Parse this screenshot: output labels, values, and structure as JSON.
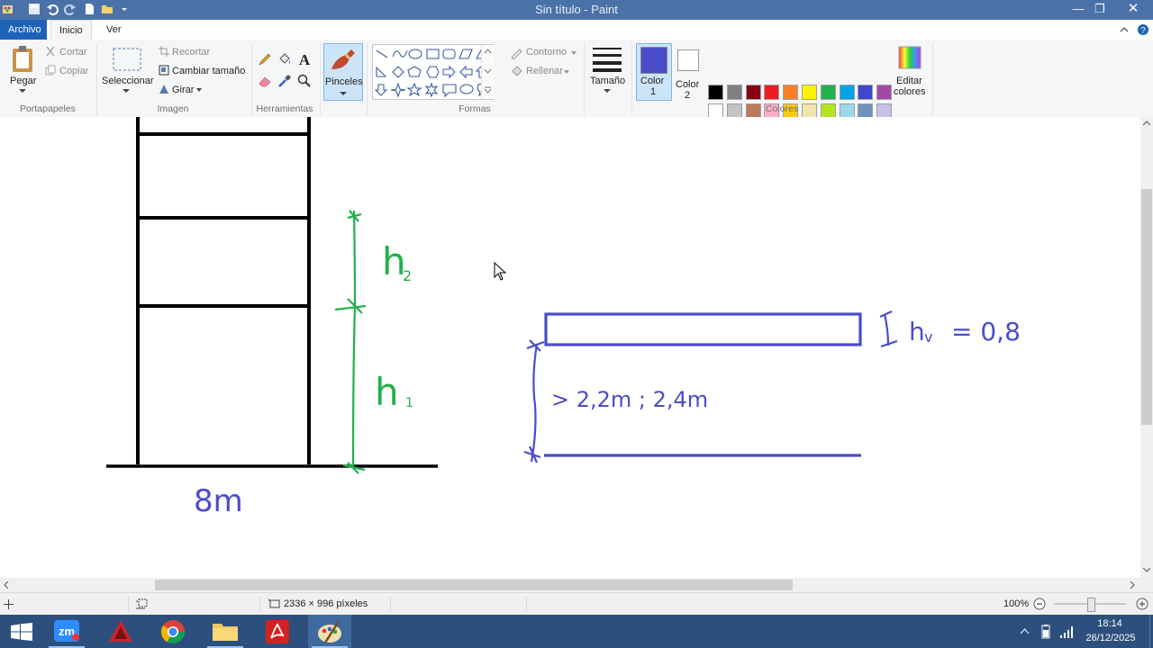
{
  "window": {
    "title": "Sin título - Paint",
    "controls": [
      "minimize",
      "restore",
      "close"
    ]
  },
  "tabs": [
    {
      "label": "Archivo"
    },
    {
      "label": "Inicio"
    },
    {
      "label": "Ver"
    }
  ],
  "ribbon": {
    "clipboard": {
      "paste": "Pegar",
      "cut": "Cortar",
      "copy": "Copiar",
      "group": "Portapapeles"
    },
    "image": {
      "select": "Seleccionar",
      "crop": "Recortar",
      "resize": "Cambiar tamaño",
      "rotate": "Girar",
      "group": "Imagen"
    },
    "tools": {
      "group": "Herramientas"
    },
    "brushes": {
      "label": "Pinceles"
    },
    "shapes": {
      "outline": "Contorno",
      "fill": "Rellenar",
      "group": "Formas"
    },
    "size": {
      "label": "Tamaño"
    },
    "colors": {
      "color1_line1": "Color",
      "color1_line2": "1",
      "color2_line1": "Color",
      "color2_line2": "2",
      "edit_line1": "Editar",
      "edit_line2": "colores",
      "group": "Colores",
      "color1": "#4a4dc8",
      "color2": "#ffffff",
      "palette_row1": [
        "#000000",
        "#7f7f7f",
        "#880015",
        "#ed1c24",
        "#ff7f27",
        "#fff200",
        "#22b14c",
        "#00a2e8",
        "#3f48cc",
        "#a349a4"
      ],
      "palette_row2": [
        "#ffffff",
        "#c3c3c3",
        "#b97a57",
        "#ffaec9",
        "#ffc90e",
        "#efe4b0",
        "#b5e61d",
        "#99d9ea",
        "#7092be",
        "#c8bfe7"
      ]
    }
  },
  "canvas": {
    "annotations": {
      "h2": "h",
      "h2_sub": "2",
      "h1": "h",
      "h1_sub": "1",
      "base": "8m",
      "hv": "h",
      "hv_sub": "v",
      "hv_value": "= 0,8",
      "clearance": "> 2,2m ; 2,4m"
    },
    "ink_colors": {
      "black": "#000000",
      "green": "#22b14c",
      "blue": "#3f48cc"
    }
  },
  "statusbar": {
    "dimensions": "2336 × 996 píxeles",
    "zoom": "100%"
  },
  "taskbar": {
    "apps": [
      "windows-start",
      "zoom",
      "autocad",
      "chrome",
      "file-explorer",
      "acrobat",
      "paint"
    ],
    "time": "18:14",
    "date": "26/12/2025"
  }
}
